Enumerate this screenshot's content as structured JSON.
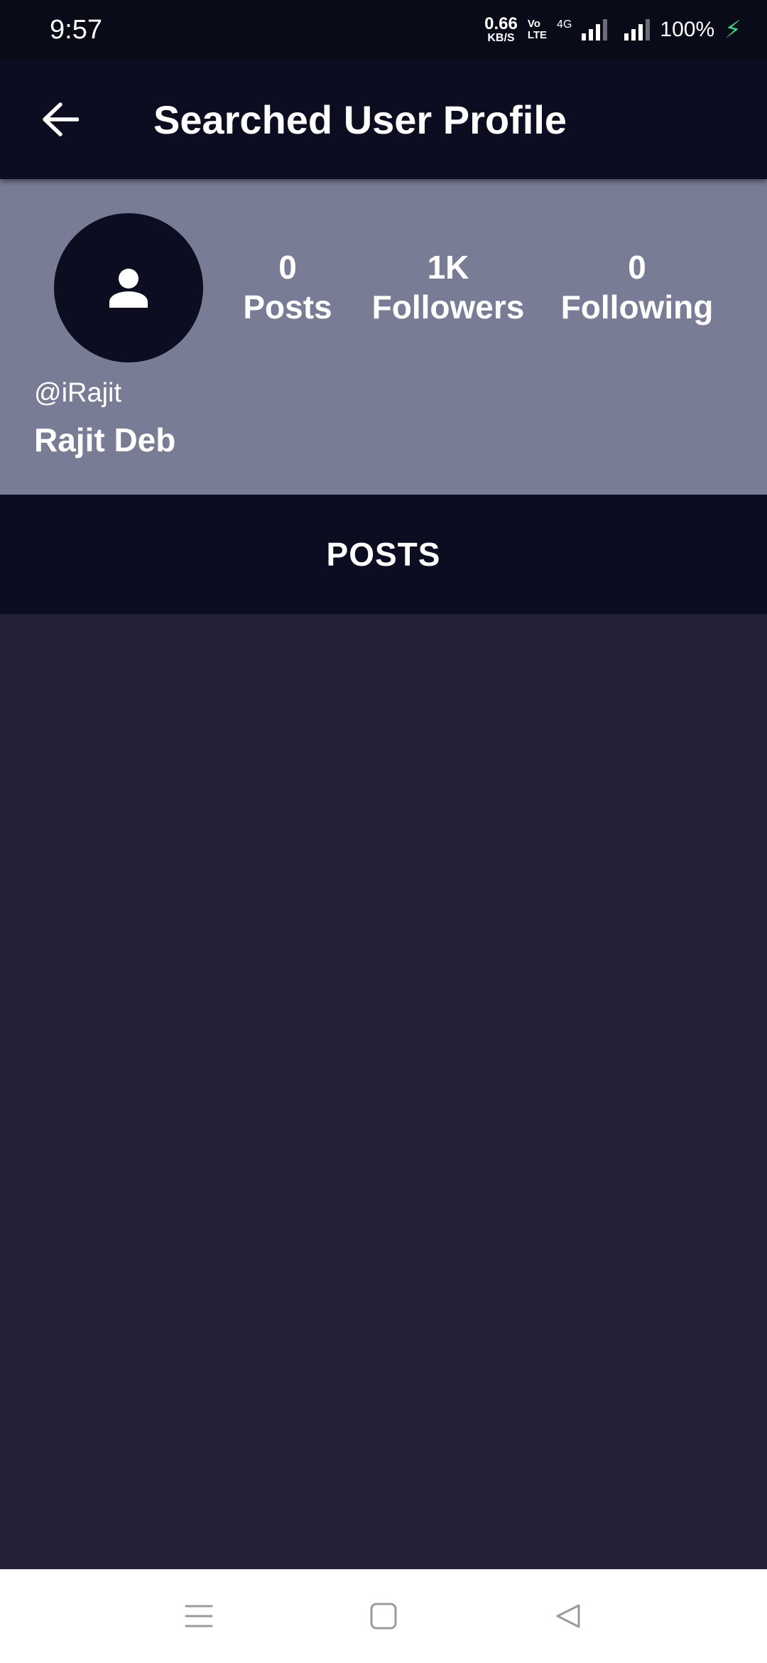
{
  "status_bar": {
    "time": "9:57",
    "net_speed_value": "0.66",
    "net_speed_unit": "KB/S",
    "volte_top": "Vo",
    "volte_bottom": "LTE",
    "network_type": "4G",
    "battery": "100%"
  },
  "app_bar": {
    "title": "Searched User Profile",
    "back_icon": "arrow-left-icon"
  },
  "profile": {
    "avatar_icon": "person-icon",
    "stats": [
      {
        "value": "0",
        "label": "Posts"
      },
      {
        "value": "1K",
        "label": "Followers"
      },
      {
        "value": "0",
        "label": "Following"
      }
    ],
    "username": "@iRajit",
    "display_name": "Rajit Deb"
  },
  "tabs": {
    "posts": "POSTS"
  },
  "nav_bar": {
    "menu_icon": "menu-icon",
    "home_icon": "home-square-icon",
    "back_icon": "back-triangle-icon"
  },
  "colors": {
    "status_bg": "#0a0b19",
    "app_bar_bg": "#0d0d22",
    "profile_bg": "#787d95",
    "content_bg": "#222136",
    "charging": "#36d07a"
  }
}
